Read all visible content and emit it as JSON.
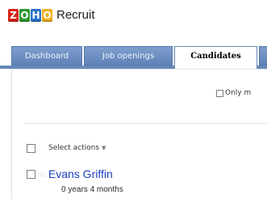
{
  "brand": {
    "logo_letters": [
      "Z",
      "O",
      "H",
      "O"
    ],
    "app_name": "Recruit"
  },
  "tabs": [
    {
      "label": "Dashboard",
      "active": false
    },
    {
      "label": "Job openings",
      "active": false
    },
    {
      "label": "Candidates",
      "active": true
    }
  ],
  "filter": {
    "only_label": "Only m"
  },
  "list": {
    "select_actions_label": "Select actions"
  },
  "candidates": [
    {
      "name": "Evans Griffin",
      "experience": "0 years 4 months"
    }
  ],
  "colors": {
    "tab_inactive": "#6f90c3",
    "tab_border": "#6688b8",
    "link": "#1a3fbf",
    "logo_z": "#d9231b",
    "logo_o1": "#2f9a32",
    "logo_h": "#2b73c9",
    "logo_o2": "#f0b21d"
  }
}
